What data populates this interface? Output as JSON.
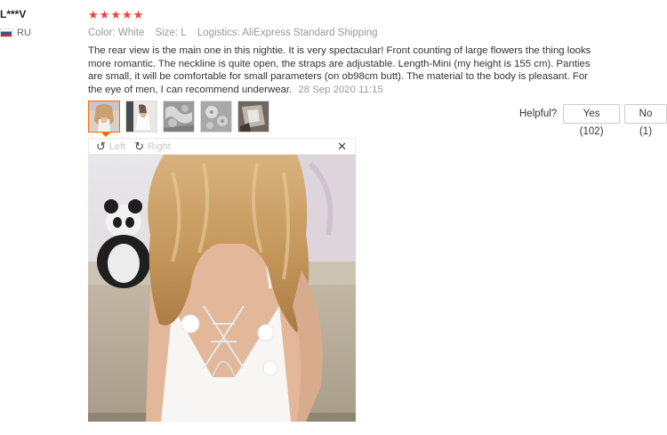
{
  "reviewer": {
    "name": "L***V",
    "country_code": "RU",
    "flag_icon": "russia-flag-icon"
  },
  "review": {
    "rating": 5,
    "star_color": "#f0433a",
    "color_label": "Color:",
    "color_value": "White",
    "size_label": "Size:",
    "size_value": "L",
    "logistics_label": "Logistics:",
    "logistics_value": "AliExpress Standard Shipping",
    "text": "The rear view is the main one in this nightie. It is very spectacular! Front counting of large flowers the thing looks more romantic. The neckline is quite open, the straps are adjustable. Length-Mini (my height is 155 cm). Panties are small, it will be comfortable for small parameters (on ob98cm butt). The material to the body is pleasant. For the eye of men, I can recommend underwear.",
    "date": "28 Sep 2020 11:15"
  },
  "helpful": {
    "label": "Helpful?",
    "yes_label": "Yes (102)",
    "no_label": "No (1)"
  },
  "viewer": {
    "rotate_left_label": "Left",
    "rotate_right_label": "Right",
    "rotate_left_icon": "rotate-left-icon",
    "rotate_right_icon": "rotate-right-icon",
    "close_icon": "close-icon",
    "active_thumb_color": "#ff6a00"
  },
  "thumbnails": [
    {
      "name": "photo-back-view",
      "active": true
    },
    {
      "name": "photo-front-view",
      "active": false
    },
    {
      "name": "photo-lace-detail-1",
      "active": false
    },
    {
      "name": "photo-lace-detail-2",
      "active": false
    },
    {
      "name": "photo-packaging",
      "active": false
    }
  ]
}
